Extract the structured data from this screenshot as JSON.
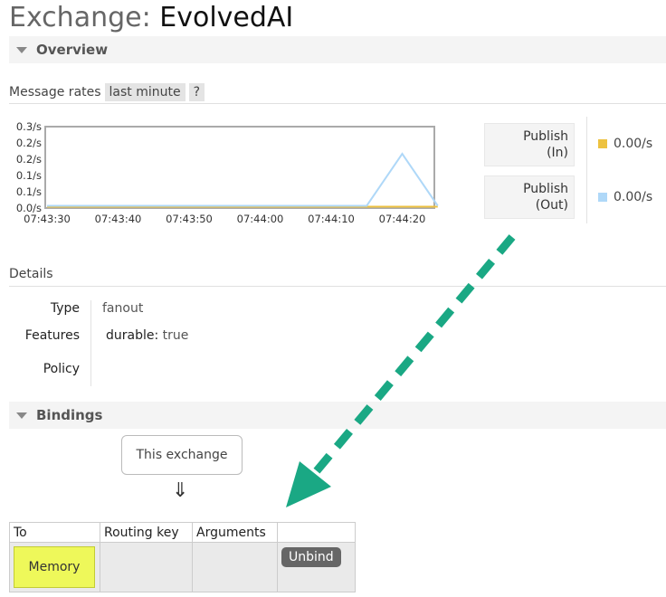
{
  "title": {
    "prefix": "Exchange:",
    "name": "EvolvedAI"
  },
  "overview": {
    "label": "Overview",
    "message_rates_label": "Message rates",
    "range_label": "last minute",
    "help_label": "?"
  },
  "chart_data": {
    "type": "line",
    "x": [
      "07:43:30",
      "07:43:40",
      "07:43:50",
      "07:44:00",
      "07:44:10",
      "07:44:20"
    ],
    "y_ticks": [
      "0.0/s",
      "0.1/s",
      "0.1/s",
      "0.2/s",
      "0.2/s",
      "0.3/s"
    ],
    "ylim": [
      0,
      0.3
    ],
    "series": [
      {
        "name": "Publish (In)",
        "color": "#edc240",
        "points": [
          [
            0,
            0
          ],
          [
            1,
            0
          ],
          [
            2,
            0
          ],
          [
            3,
            0
          ],
          [
            4,
            0
          ],
          [
            5,
            0
          ],
          [
            5.5,
            0
          ]
        ]
      },
      {
        "name": "Publish (Out)",
        "color": "#afd8f8",
        "points": [
          [
            0,
            0
          ],
          [
            1,
            0
          ],
          [
            2,
            0
          ],
          [
            3,
            0
          ],
          [
            4,
            0
          ],
          [
            4.5,
            0
          ],
          [
            5,
            0.2
          ],
          [
            5.5,
            0
          ]
        ]
      }
    ]
  },
  "legend": [
    {
      "label_line1": "Publish",
      "label_line2": "(In)",
      "value": "0.00/s",
      "color": "#edc240"
    },
    {
      "label_line1": "Publish",
      "label_line2": "(Out)",
      "value": "0.00/s",
      "color": "#afd8f8"
    }
  ],
  "details": {
    "label": "Details",
    "type_key": "Type",
    "type_value": "fanout",
    "features_key": "Features",
    "durable_key": "durable:",
    "durable_value": "true",
    "policy_key": "Policy"
  },
  "bindings": {
    "label": "Bindings",
    "this_exchange": "This exchange",
    "down_arrow": "⇓",
    "columns": [
      "To",
      "Routing key",
      "Arguments",
      ""
    ],
    "row": {
      "to": "Memory",
      "routing_key": "",
      "arguments": "",
      "action": "Unbind"
    }
  },
  "accent_color": "#1aa884"
}
